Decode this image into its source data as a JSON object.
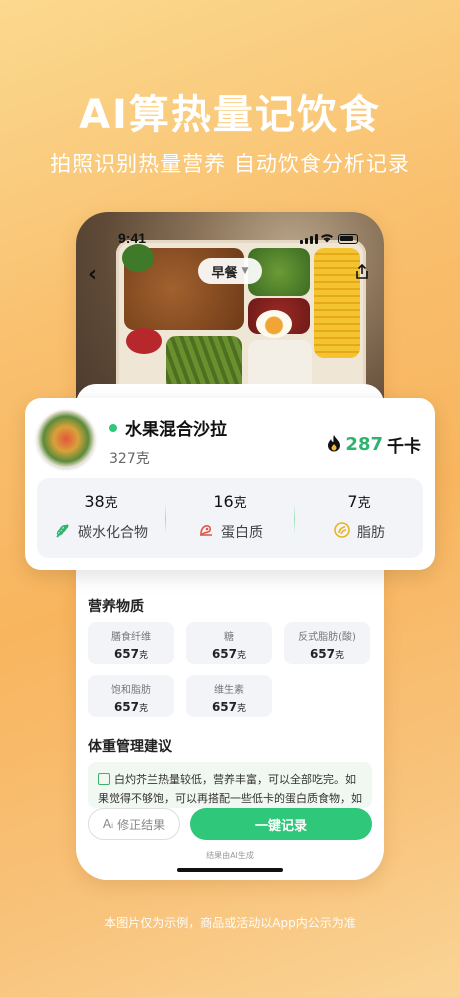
{
  "promo": {
    "headline": "AI算热量记饮食",
    "subline": "拍照识别热量营养 自动饮食分析记录",
    "disclaimer": "本图片仅为示例，商品或活动以App内公示为准"
  },
  "status_bar": {
    "time": "9:41"
  },
  "meal_selector": {
    "label": "早餐"
  },
  "food_card": {
    "name": "水果混合沙拉",
    "weight": "327克",
    "calories": "287",
    "calories_unit": "千卡",
    "macros": [
      {
        "value": "38",
        "unit": "克",
        "label": "碳水化合物",
        "icon": "wheat-icon",
        "color": "#2fb36d"
      },
      {
        "value": "16",
        "unit": "克",
        "label": "蛋白质",
        "icon": "meat-icon",
        "color": "#e05a4a"
      },
      {
        "value": "7",
        "unit": "克",
        "label": "脂肪",
        "icon": "oil-icon",
        "color": "#e9b41f"
      }
    ]
  },
  "nutrition": {
    "title": "营养物质",
    "items": [
      {
        "label": "膳食纤维",
        "value": "657",
        "unit": "克"
      },
      {
        "label": "糖",
        "value": "657",
        "unit": "克"
      },
      {
        "label": "反式脂肪(酸)",
        "value": "657",
        "unit": "克"
      },
      {
        "label": "饱和脂肪",
        "value": "657",
        "unit": "克"
      },
      {
        "label": "维生素",
        "value": "657",
        "unit": "克"
      }
    ]
  },
  "advice": {
    "title": "体重管理建议",
    "text": "白灼芥兰热量较低，营养丰富，可以全部吃完。如果觉得不够饱，可以再搭配一些低卡的蛋白质食物，如"
  },
  "actions": {
    "fix_label": "修正结果",
    "record_label": "一键记录",
    "ai_note": "结果由AI生成"
  },
  "colors": {
    "accent": "#2fc77a",
    "calorie": "#2fb36d"
  }
}
